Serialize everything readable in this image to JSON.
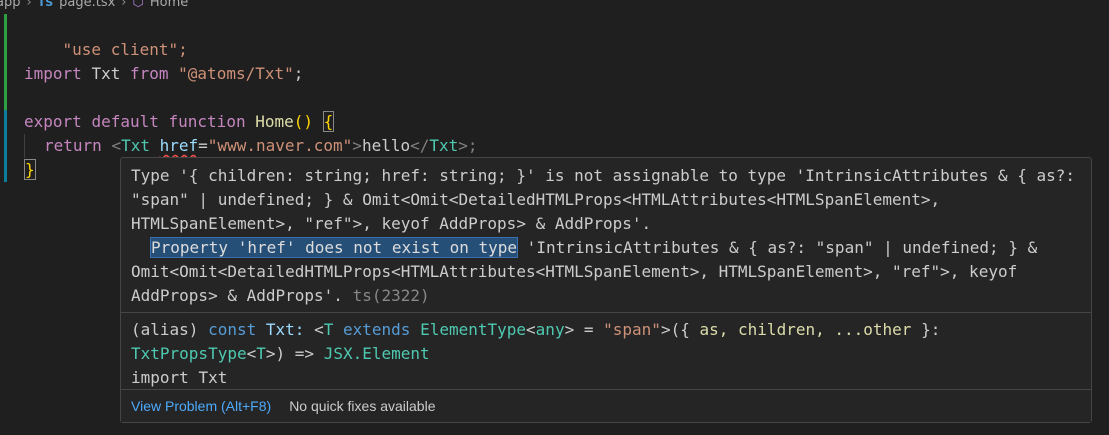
{
  "breadcrumb": {
    "items": [
      "app",
      "TS",
      "page.tsx",
      "Home"
    ]
  },
  "code": {
    "l1": "\"use client\";",
    "l3_import": "import",
    "l3_name": "Txt",
    "l3_from": "from",
    "l3_path": "\"@atoms/Txt\"",
    "l3_end": ";",
    "l5_export": "export",
    "l5_default": "default",
    "l5_function": "function",
    "l5_name": "Home",
    "l5_parens": "()",
    "l5_brace": "{",
    "l6_return": "return",
    "l6_lt": "<",
    "l6_tag": "Txt",
    "l6_attr": "href",
    "l6_eq": "=",
    "l6_val": "\"www.naver.com\"",
    "l6_gt": ">",
    "l6_text": "hello",
    "l6_close_lt": "</",
    "l6_close_tag": "Txt",
    "l6_close_gt": ">;",
    "l7_brace": "}"
  },
  "hover": {
    "line1": "Type '{ children: string; href: string; }' is not assignable to type 'IntrinsicAttributes & { as?:",
    "line2": "\"span\" | undefined; } & Omit<Omit<DetailedHTMLProps<HTMLAttributes<HTMLSpanElement>,",
    "line3": "HTMLSpanElement>, \"ref\">, keyof AddProps> & AddProps'.",
    "line4_sel": "Property 'href' does not exist on type",
    "line4_rest": " 'IntrinsicAttributes & { as?: \"span\" | undefined; } &",
    "line5": "Omit<Omit<DetailedHTMLProps<HTMLAttributes<HTMLSpanElement>, HTMLSpanElement>, \"ref\">, keyof",
    "line6": "AddProps> & AddProps'.",
    "line6_code": "ts(2322)",
    "sig": {
      "alias": "(alias)",
      "const": "const",
      "name": "Txt:",
      "lt": "<",
      "T": "T",
      "extends": "extends",
      "elementType": "ElementType",
      "any_open": "<",
      "any": "any",
      "any_close": ">",
      "eq": "=",
      "span": "\"span\"",
      "gt": ">",
      "open": "({",
      "as": "as,",
      "children": "children,",
      "other": "...other",
      "close": "}:",
      "propsType": "TxtPropsType",
      "pt_lt": "<",
      "pt_T": "T",
      "pt_gt": ">",
      "arrow": ") =>",
      "jsx": "JSX.Element",
      "import": "import",
      "import_name": "Txt"
    },
    "status_link": "View Problem (Alt+F8)",
    "status_note": "No quick fixes available"
  }
}
